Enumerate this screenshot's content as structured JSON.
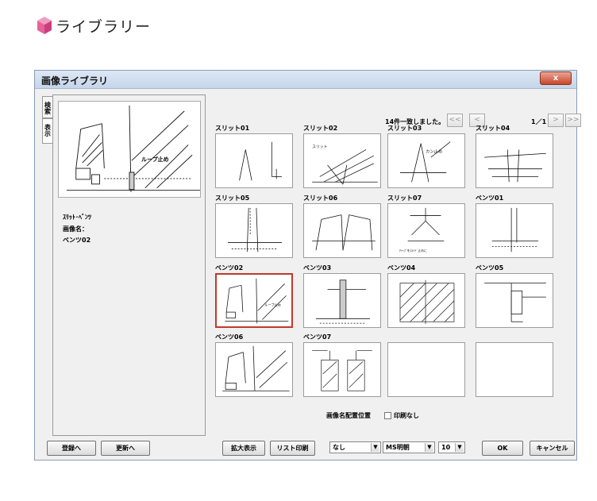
{
  "page": {
    "heading": "ライブラリー"
  },
  "window": {
    "title": "画像ライブラリ",
    "close_glyph": "x"
  },
  "tabs": {
    "search": "検索",
    "display": "表示"
  },
  "preview": {
    "category": "ｽﾘｯﾄ･ﾍﾞﾝﾂ",
    "name_label": "画像名：",
    "name": "ベンツ02"
  },
  "results": {
    "count_text": "14件一致しました。",
    "page_indicator": "1／1",
    "nav": {
      "first": "<<",
      "prev": "<",
      "next": ">",
      "last": ">>"
    }
  },
  "thumbnails": [
    {
      "label": "スリット01"
    },
    {
      "label": "スリット02"
    },
    {
      "label": "スリット03"
    },
    {
      "label": "スリット04"
    },
    {
      "label": "スリット05"
    },
    {
      "label": "スリット06"
    },
    {
      "label": "スリット07"
    },
    {
      "label": "ベンツ01"
    },
    {
      "label": "ベンツ02",
      "selected": true
    },
    {
      "label": "ベンツ03"
    },
    {
      "label": "ベンツ04"
    },
    {
      "label": "ベンツ05"
    },
    {
      "label": "ベンツ06"
    },
    {
      "label": "ベンツ07"
    }
  ],
  "sketch_texts": {
    "loop_stop": "ループ止め",
    "slit": "スリット",
    "can_stop": "カン止め",
    "tiny_note": "ﾁｬｯﾌﾟをｽﾗｲﾄﾞ止めに"
  },
  "buttons": {
    "register": "登録へ",
    "update": "更新へ",
    "zoom": "拡大表示",
    "print_list": "リスト印刷",
    "ok": "OK",
    "cancel": "キャンセル"
  },
  "options": {
    "caption_position_label": "画像名配置位置",
    "no_print_label": "印刷なし",
    "caption_position_value": "なし",
    "font_value": "MS明朝",
    "font_size_value": "10"
  },
  "colors": {
    "selection_border": "#c0392b",
    "close_button": "#c9462c",
    "cube_pink": "#e8619a"
  }
}
